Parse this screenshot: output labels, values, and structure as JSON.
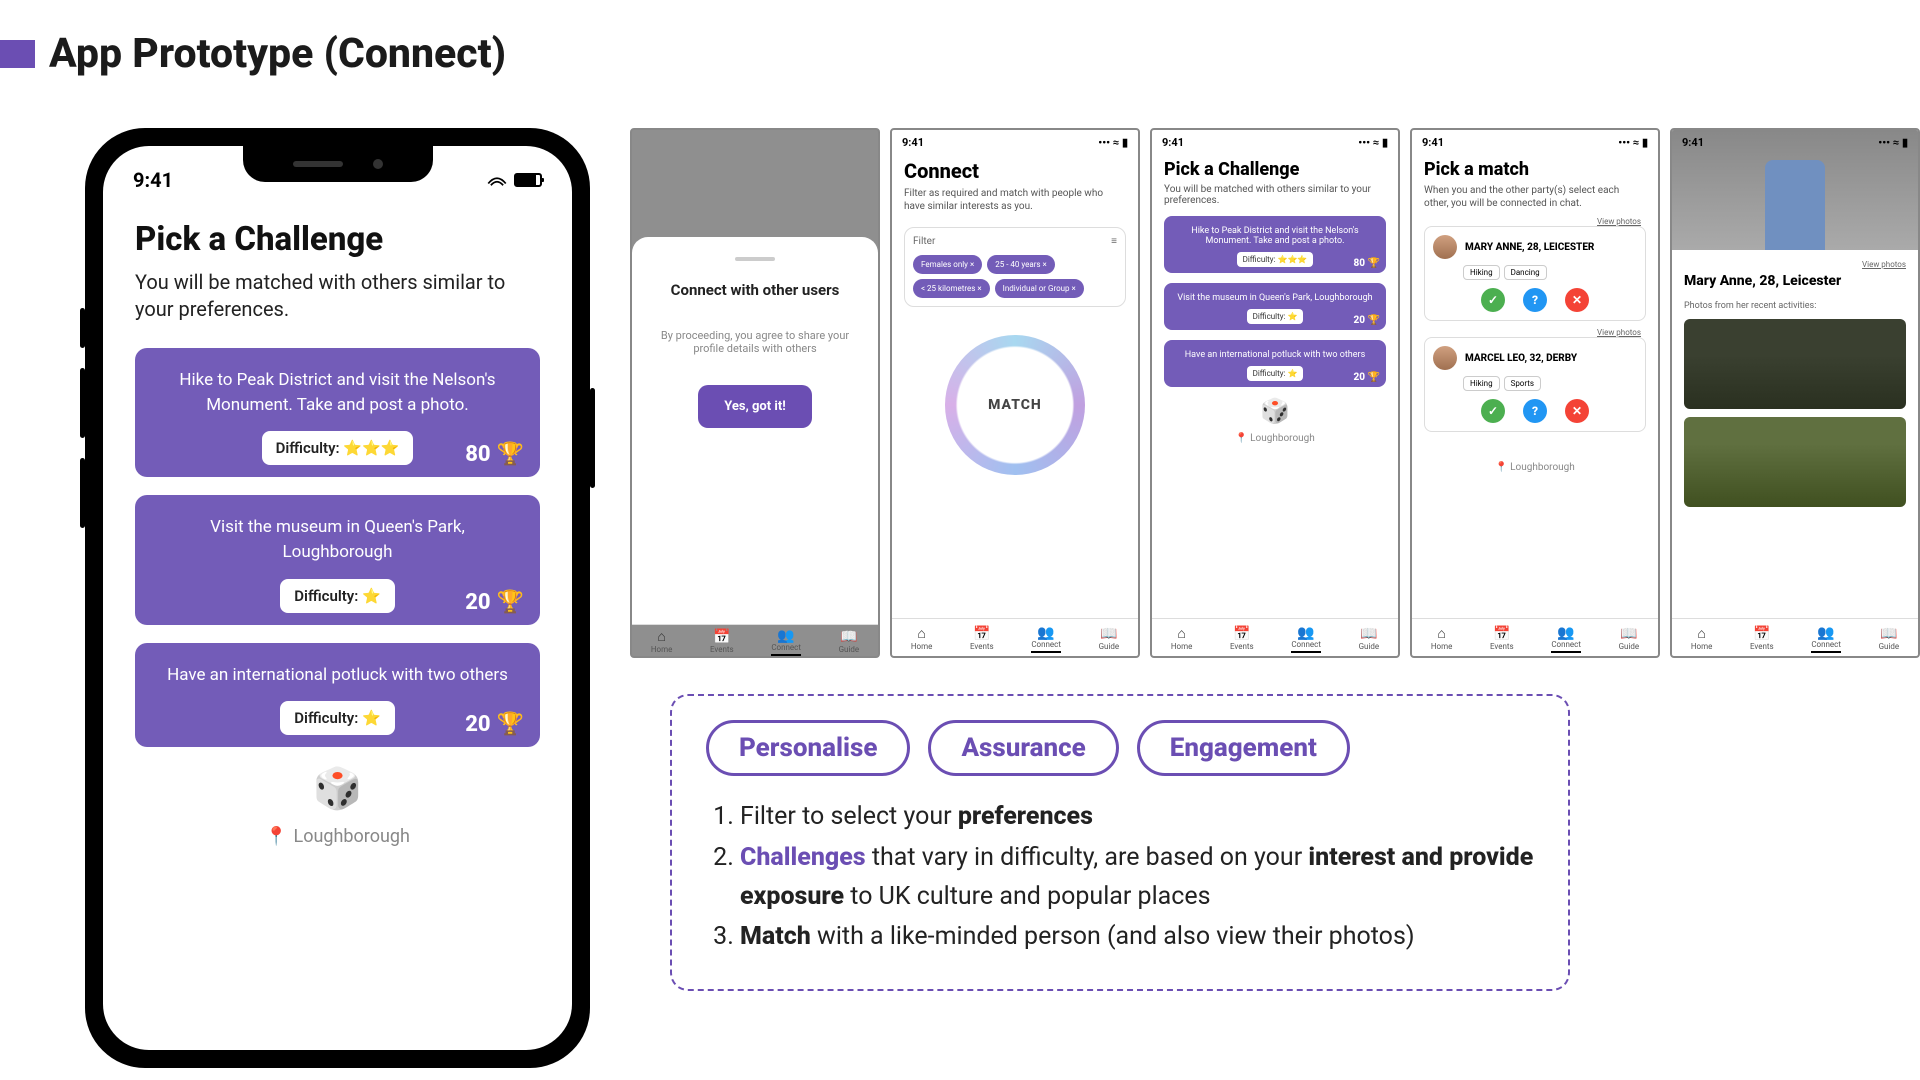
{
  "slide_title": "App Prototype (Connect)",
  "status_time": "9:41",
  "main_phone": {
    "title": "Pick a Challenge",
    "subtitle": "You will be matched with others similar to your preferences.",
    "challenges": [
      {
        "text": "Hike to Peak District and visit the Nelson's Monument. Take and post a photo.",
        "difficulty": "Difficulty: ⭐⭐⭐",
        "points": "80"
      },
      {
        "text": "Visit the museum in Queen's Park, Loughborough",
        "difficulty": "Difficulty: ⭐",
        "points": "20"
      },
      {
        "text": "Have an international potluck with two others",
        "difficulty": "Difficulty: ⭐",
        "points": "20"
      }
    ],
    "location": "Loughborough"
  },
  "thumb1": {
    "drawer_title": "Connect with other users",
    "drawer_body": "By proceeding, you agree to share your profile details with others",
    "cta": "Yes, got it!"
  },
  "thumb2": {
    "title": "Connect",
    "sub": "Filter as required and match with people who have similar interests as you.",
    "filter_label": "Filter",
    "chips": [
      "Females only ×",
      "25 - 40 years ×",
      "< 25 kilometres ×",
      "Individual or Group ×"
    ],
    "match": "MATCH"
  },
  "thumb3": {
    "title": "Pick a Challenge",
    "sub": "You will be matched with others similar to your preferences.",
    "ch": [
      {
        "t": "Hike to Peak District and visit the Nelson's Monument. Take and post a photo.",
        "d": "Difficulty: ⭐⭐⭐",
        "p": "80 🏆"
      },
      {
        "t": "Visit the museum in Queen's Park, Loughborough",
        "d": "Difficulty: ⭐",
        "p": "20 🏆"
      },
      {
        "t": "Have an international potluck with two others",
        "d": "Difficulty: ⭐",
        "p": "20 🏆"
      }
    ],
    "location": "Loughborough"
  },
  "thumb4": {
    "title": "Pick a match",
    "sub": "When you and the other party(s) select each other, you will be connected in chat.",
    "view_photos": "View photos",
    "matches": [
      {
        "name": "MARY ANNE, 28, LEICESTER",
        "tags": [
          "Hiking",
          "Dancing"
        ]
      },
      {
        "name": "MARCEL LEO, 32, DERBY",
        "tags": [
          "Hiking",
          "Sports"
        ]
      }
    ],
    "location": "Loughborough"
  },
  "thumb5": {
    "name": "Mary Anne, 28, Leicester",
    "view_photos": "View photos",
    "photos_label": "Photos from her recent activities:"
  },
  "tabs": [
    "Home",
    "Events",
    "Connect",
    "Guide"
  ],
  "callout": {
    "pills": [
      "Personalise",
      "Assurance",
      "Engagement"
    ],
    "bullet1a": "Filter to select your ",
    "bullet1b": "preferences",
    "bullet2a": "Challenges",
    "bullet2b": " that vary in difficulty, are based on your ",
    "bullet2c": "interest and provide exposure",
    "bullet2d": " to UK culture and popular places",
    "bullet3a": "Match",
    "bullet3b": " with a like-minded person (and also view their photos)"
  }
}
